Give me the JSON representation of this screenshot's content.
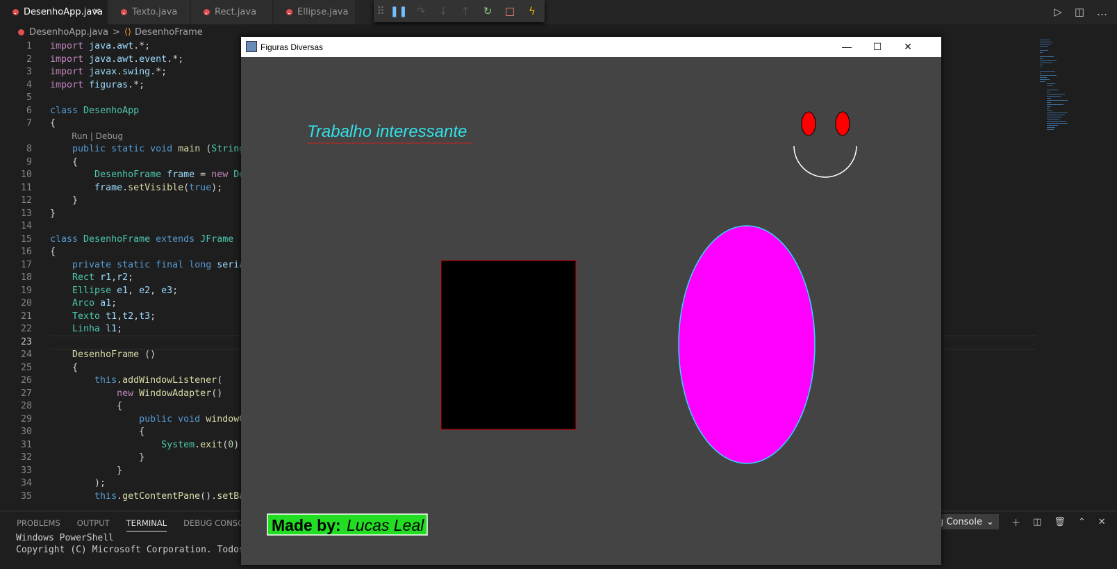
{
  "tabs": [
    {
      "label": "DesenhoApp.java",
      "active": true
    },
    {
      "label": "Texto.java",
      "active": false
    },
    {
      "label": "Rect.java",
      "active": false
    },
    {
      "label": "Ellipse.java",
      "active": false
    }
  ],
  "breadcrumb": {
    "file": "DesenhoApp.java",
    "separator": ">",
    "symbol": "DesenhoFrame"
  },
  "codelens": "Run | Debug",
  "code_lines": [
    {
      "n": "1",
      "tokens": [
        [
          "kw2",
          "import"
        ],
        [
          "pl",
          " "
        ],
        [
          "var",
          "java"
        ],
        [
          "pl",
          "."
        ],
        [
          "var",
          "awt"
        ],
        [
          "pl",
          ".*;"
        ]
      ]
    },
    {
      "n": "2",
      "tokens": [
        [
          "kw2",
          "import"
        ],
        [
          "pl",
          " "
        ],
        [
          "var",
          "java"
        ],
        [
          "pl",
          "."
        ],
        [
          "var",
          "awt"
        ],
        [
          "pl",
          "."
        ],
        [
          "var",
          "event"
        ],
        [
          "pl",
          ".*;"
        ]
      ]
    },
    {
      "n": "3",
      "tokens": [
        [
          "kw2",
          "import"
        ],
        [
          "pl",
          " "
        ],
        [
          "var",
          "javax"
        ],
        [
          "pl",
          "."
        ],
        [
          "var",
          "swing"
        ],
        [
          "pl",
          ".*;"
        ]
      ]
    },
    {
      "n": "4",
      "tokens": [
        [
          "kw2",
          "import"
        ],
        [
          "pl",
          " "
        ],
        [
          "var",
          "figuras"
        ],
        [
          "pl",
          ".*;"
        ]
      ]
    },
    {
      "n": "5",
      "tokens": []
    },
    {
      "n": "6",
      "tokens": [
        [
          "kw",
          "class"
        ],
        [
          "pl",
          " "
        ],
        [
          "ty",
          "DesenhoApp"
        ]
      ]
    },
    {
      "n": "7",
      "tokens": [
        [
          "pl",
          "{"
        ]
      ]
    },
    {
      "n": "8",
      "tokens": [
        [
          "pl",
          "    "
        ],
        [
          "kw",
          "public"
        ],
        [
          "pl",
          " "
        ],
        [
          "kw",
          "static"
        ],
        [
          "pl",
          " "
        ],
        [
          "kw",
          "void"
        ],
        [
          "pl",
          " "
        ],
        [
          "fn",
          "main"
        ],
        [
          "pl",
          " ("
        ],
        [
          "ty",
          "String"
        ],
        [
          "pl",
          "["
        ]
      ]
    },
    {
      "n": "9",
      "tokens": [
        [
          "pl",
          "    {"
        ]
      ]
    },
    {
      "n": "10",
      "tokens": [
        [
          "pl",
          "        "
        ],
        [
          "ty",
          "DesenhoFrame"
        ],
        [
          "pl",
          " "
        ],
        [
          "var",
          "frame"
        ],
        [
          "pl",
          " = "
        ],
        [
          "kw2",
          "new"
        ],
        [
          "pl",
          " "
        ],
        [
          "ty",
          "Des"
        ]
      ]
    },
    {
      "n": "11",
      "tokens": [
        [
          "pl",
          "        "
        ],
        [
          "var",
          "frame"
        ],
        [
          "pl",
          "."
        ],
        [
          "fn",
          "setVisible"
        ],
        [
          "pl",
          "("
        ],
        [
          "kw",
          "true"
        ],
        [
          "pl",
          ");"
        ]
      ]
    },
    {
      "n": "12",
      "tokens": [
        [
          "pl",
          "    }"
        ]
      ]
    },
    {
      "n": "13",
      "tokens": [
        [
          "pl",
          "}"
        ]
      ]
    },
    {
      "n": "14",
      "tokens": []
    },
    {
      "n": "15",
      "tokens": [
        [
          "kw",
          "class"
        ],
        [
          "pl",
          " "
        ],
        [
          "ty",
          "DesenhoFrame"
        ],
        [
          "pl",
          " "
        ],
        [
          "kw",
          "extends"
        ],
        [
          "pl",
          " "
        ],
        [
          "ty",
          "JFrame"
        ]
      ]
    },
    {
      "n": "16",
      "tokens": [
        [
          "pl",
          "{"
        ]
      ]
    },
    {
      "n": "17",
      "tokens": [
        [
          "pl",
          "    "
        ],
        [
          "kw",
          "private"
        ],
        [
          "pl",
          " "
        ],
        [
          "kw",
          "static"
        ],
        [
          "pl",
          " "
        ],
        [
          "kw",
          "final"
        ],
        [
          "pl",
          " "
        ],
        [
          "kw",
          "long"
        ],
        [
          "pl",
          " "
        ],
        [
          "var",
          "serial"
        ]
      ]
    },
    {
      "n": "18",
      "tokens": [
        [
          "pl",
          "    "
        ],
        [
          "ty",
          "Rect"
        ],
        [
          "pl",
          " "
        ],
        [
          "var",
          "r1"
        ],
        [
          "pl",
          ","
        ],
        [
          "var",
          "r2"
        ],
        [
          "pl",
          ";"
        ]
      ]
    },
    {
      "n": "19",
      "tokens": [
        [
          "pl",
          "    "
        ],
        [
          "ty",
          "Ellipse"
        ],
        [
          "pl",
          " "
        ],
        [
          "var",
          "e1"
        ],
        [
          "pl",
          ", "
        ],
        [
          "var",
          "e2"
        ],
        [
          "pl",
          ", "
        ],
        [
          "var",
          "e3"
        ],
        [
          "pl",
          ";"
        ]
      ]
    },
    {
      "n": "20",
      "tokens": [
        [
          "pl",
          "    "
        ],
        [
          "ty",
          "Arco"
        ],
        [
          "pl",
          " "
        ],
        [
          "var",
          "a1"
        ],
        [
          "pl",
          ";"
        ]
      ]
    },
    {
      "n": "21",
      "tokens": [
        [
          "pl",
          "    "
        ],
        [
          "ty",
          "Texto"
        ],
        [
          "pl",
          " "
        ],
        [
          "var",
          "t1"
        ],
        [
          "pl",
          ","
        ],
        [
          "var",
          "t2"
        ],
        [
          "pl",
          ","
        ],
        [
          "var",
          "t3"
        ],
        [
          "pl",
          ";"
        ]
      ]
    },
    {
      "n": "22",
      "tokens": [
        [
          "pl",
          "    "
        ],
        [
          "ty",
          "Linha"
        ],
        [
          "pl",
          " "
        ],
        [
          "var",
          "l1"
        ],
        [
          "pl",
          ";"
        ]
      ]
    },
    {
      "n": "23",
      "tokens": []
    },
    {
      "n": "24",
      "tokens": [
        [
          "pl",
          "    "
        ],
        [
          "fn",
          "DesenhoFrame"
        ],
        [
          "pl",
          " ()"
        ]
      ]
    },
    {
      "n": "25",
      "tokens": [
        [
          "pl",
          "    {"
        ]
      ]
    },
    {
      "n": "26",
      "tokens": [
        [
          "pl",
          "        "
        ],
        [
          "kw",
          "this"
        ],
        [
          "pl",
          "."
        ],
        [
          "fn",
          "addWindowListener"
        ],
        [
          "pl",
          "("
        ]
      ]
    },
    {
      "n": "27",
      "tokens": [
        [
          "pl",
          "            "
        ],
        [
          "kw2",
          "new"
        ],
        [
          "pl",
          " "
        ],
        [
          "fn",
          "WindowAdapter"
        ],
        [
          "pl",
          "()"
        ]
      ]
    },
    {
      "n": "28",
      "tokens": [
        [
          "pl",
          "            {"
        ]
      ]
    },
    {
      "n": "29",
      "tokens": [
        [
          "pl",
          "                "
        ],
        [
          "kw",
          "public"
        ],
        [
          "pl",
          " "
        ],
        [
          "kw",
          "void"
        ],
        [
          "pl",
          " "
        ],
        [
          "fn",
          "windowCl"
        ]
      ]
    },
    {
      "n": "30",
      "tokens": [
        [
          "pl",
          "                {"
        ]
      ]
    },
    {
      "n": "31",
      "tokens": [
        [
          "pl",
          "                    "
        ],
        [
          "ty",
          "System"
        ],
        [
          "pl",
          "."
        ],
        [
          "fn",
          "exit"
        ],
        [
          "pl",
          "("
        ],
        [
          "num",
          "0"
        ],
        [
          "pl",
          ");"
        ]
      ]
    },
    {
      "n": "32",
      "tokens": [
        [
          "pl",
          "                }"
        ]
      ]
    },
    {
      "n": "33",
      "tokens": [
        [
          "pl",
          "            }"
        ]
      ]
    },
    {
      "n": "34",
      "tokens": [
        [
          "pl",
          "        );"
        ]
      ]
    },
    {
      "n": "35",
      "tokens": [
        [
          "pl",
          "        "
        ],
        [
          "kw",
          "this"
        ],
        [
          "pl",
          "."
        ],
        [
          "fn",
          "getContentPane"
        ],
        [
          "pl",
          "()."
        ],
        [
          "fn",
          "setBac"
        ]
      ]
    }
  ],
  "panel": {
    "tabs": [
      "PROBLEMS",
      "OUTPUT",
      "TERMINAL",
      "DEBUG CONSOLE"
    ],
    "active_tab": "TERMINAL",
    "terminal_lines": [
      "Windows PowerShell",
      "Copyright (C) Microsoft Corporation. Todos os"
    ],
    "select_value": "g Console"
  },
  "java_window": {
    "title": "Figuras Diversas",
    "canvas_text": "Trabalho interessante",
    "footer_bold": "Made by:",
    "footer_italic": "Lucas Leal",
    "colors": {
      "background": "#444444",
      "text": "#33e0e8",
      "eyes": "#ff0000",
      "ellipse_fill": "#ff00ff",
      "ellipse_stroke": "#33d6ff",
      "rect_fill": "#000000",
      "rect_stroke": "#cc0000",
      "badge": "#22dd22"
    }
  },
  "icons": [
    "java-file-icon",
    "close-icon",
    "pause-icon",
    "step-over-icon",
    "step-into-icon",
    "step-out-icon",
    "restart-icon",
    "stop-icon",
    "lightning-icon",
    "run-icon",
    "split-editor-icon",
    "add-terminal-icon",
    "trash-icon",
    "chevron-up-icon",
    "minimize-icon",
    "maximize-icon"
  ]
}
